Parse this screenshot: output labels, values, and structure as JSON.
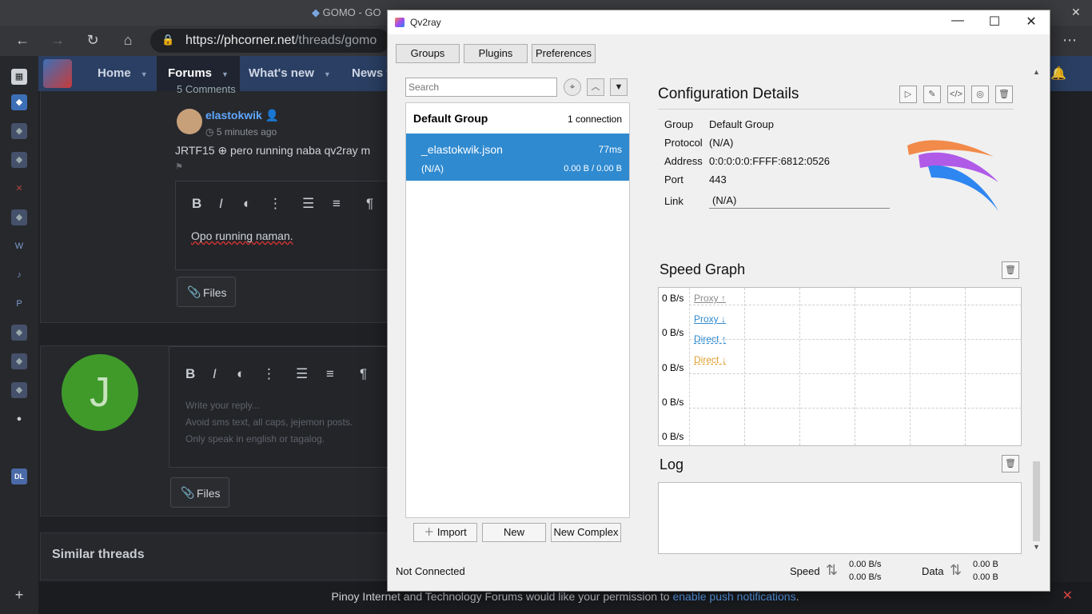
{
  "browser": {
    "tab_title": "GOMO - GO",
    "url_host": "https://phcorner.net",
    "url_path": "/threads/gomo",
    "nav": {
      "home": "Home",
      "forums": "Forums",
      "whats_new": "What's new",
      "news": "News f"
    },
    "post": {
      "comments_label": "5 Comments",
      "author": "elastokwik",
      "time": "5 minutes ago",
      "text": "JRTF15 ⊕ pero running naba qv2ray m",
      "editor_text": "Opo running naman.",
      "files_label": "Files"
    },
    "reply": {
      "avatar_letter": "J",
      "placeholder_1": "Write your reply...",
      "placeholder_2": "Avoid sms text, all caps, jejemon posts.",
      "placeholder_3": "Only speak in english or tagalog.",
      "files_label": "Files"
    },
    "similar_threads": "Similar threads",
    "push_notice": {
      "text": "Pinoy Internet and Technology Forums would like your permission to ",
      "link": "enable push notifications",
      "end": "."
    }
  },
  "qv2ray": {
    "title": "Qv2ray",
    "toolbar": {
      "groups": "Groups",
      "plugins": "Plugins",
      "preferences": "Preferences"
    },
    "search_placeholder": "Search",
    "group": {
      "name": "Default Group",
      "count": "1 connection"
    },
    "connection": {
      "name": "_elastokwik.json",
      "latency": "77ms",
      "protocol": "(N/A)",
      "traffic": "0.00 B / 0.00 B"
    },
    "list_buttons": {
      "import": "Import",
      "new": "New",
      "new_complex": "New Complex"
    },
    "config": {
      "title": "Configuration Details",
      "group_label": "Group",
      "group_value": "Default Group",
      "protocol_label": "Protocol",
      "protocol_value": "(N/A)",
      "address_label": "Address",
      "address_value": "0:0:0:0:0:FFFF:6812:0526",
      "port_label": "Port",
      "port_value": "443",
      "link_label": "Link",
      "link_value": "(N/A)"
    },
    "speed_graph": {
      "title": "Speed Graph",
      "y_labels": [
        "0 B/s",
        "0 B/s",
        "0 B/s",
        "0 B/s",
        "0 B/s"
      ],
      "legend": [
        {
          "label": "Proxy ↑",
          "color": "#8a8a8a"
        },
        {
          "label": "Proxy ↓",
          "color": "#2f8ad0"
        },
        {
          "label": "Direct ↑",
          "color": "#2f8ad0"
        },
        {
          "label": "Direct ↓",
          "color": "#e0a030"
        }
      ]
    },
    "log": {
      "title": "Log"
    },
    "status": {
      "connection": "Not Connected",
      "speed_label": "Speed",
      "speed_up": "0.00 B/s",
      "speed_down": "0.00 B/s",
      "data_label": "Data",
      "data_up": "0.00 B",
      "data_down": "0.00 B"
    }
  }
}
